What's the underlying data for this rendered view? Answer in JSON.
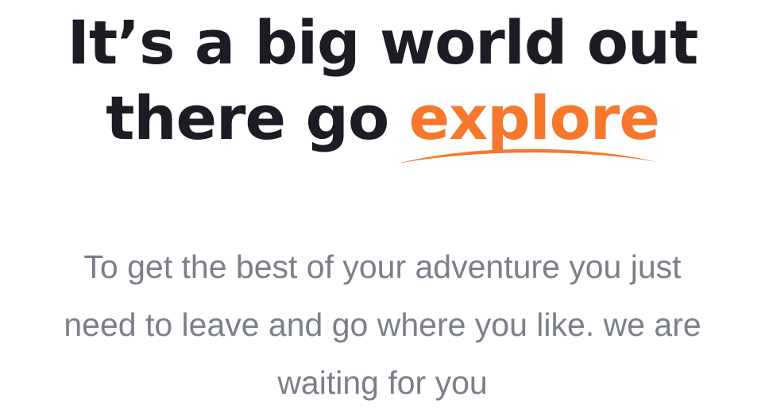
{
  "hero": {
    "headline": {
      "line1": "It’s a big world out",
      "line2_prefix": "there go",
      "accent_word": "explore"
    },
    "subtitle": {
      "line1": "To get the best of your adventure you just",
      "line2": "need to leave and go where you like. we are",
      "line3": "waiting for you"
    }
  },
  "colors": {
    "heading": "#1b1c24",
    "accent": "#f7782c",
    "subtitle": "#7b7f89",
    "background": "#ffffff"
  },
  "icons": {
    "underline": "swoosh-underline-icon"
  }
}
